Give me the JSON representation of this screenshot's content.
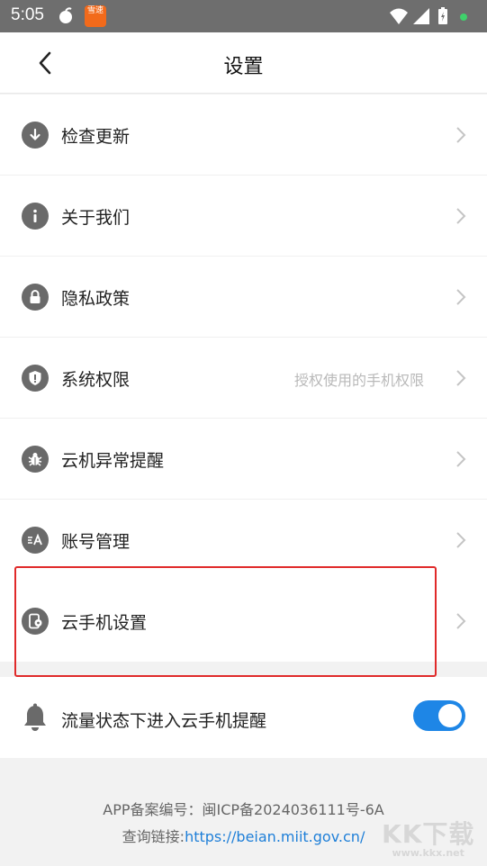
{
  "status_bar": {
    "time": "5:05",
    "badge_text": "雪速"
  },
  "header": {
    "title": "设置"
  },
  "rows": [
    {
      "label": "检查更新",
      "icon": "download-arrow-icon"
    },
    {
      "label": "关于我们",
      "icon": "info-icon"
    },
    {
      "label": "隐私政策",
      "icon": "lock-icon"
    },
    {
      "label": "系统权限",
      "icon": "shield-icon",
      "hint": "授权使用的手机权限"
    },
    {
      "label": "云机异常提醒",
      "icon": "bug-icon"
    },
    {
      "label": "账号管理",
      "icon": "account-icon"
    },
    {
      "label": "云手机设置",
      "icon": "phone-settings-icon"
    }
  ],
  "toggle_row": {
    "label": "流量状态下进入云手机提醒",
    "icon": "bell-icon",
    "enabled": true
  },
  "footer": {
    "icp_line": "APP备案编号：闽ICP备2024036111号-6A",
    "query_prefix": "查询链接:",
    "query_link": "https://beian.miit.gov.cn/"
  },
  "watermark": {
    "text": "KK下载",
    "sub": "www.kkx.net"
  },
  "colors": {
    "accent": "#1e86e6",
    "highlight_box": "#e02a2a",
    "status_bar": "#6e6e6e"
  }
}
